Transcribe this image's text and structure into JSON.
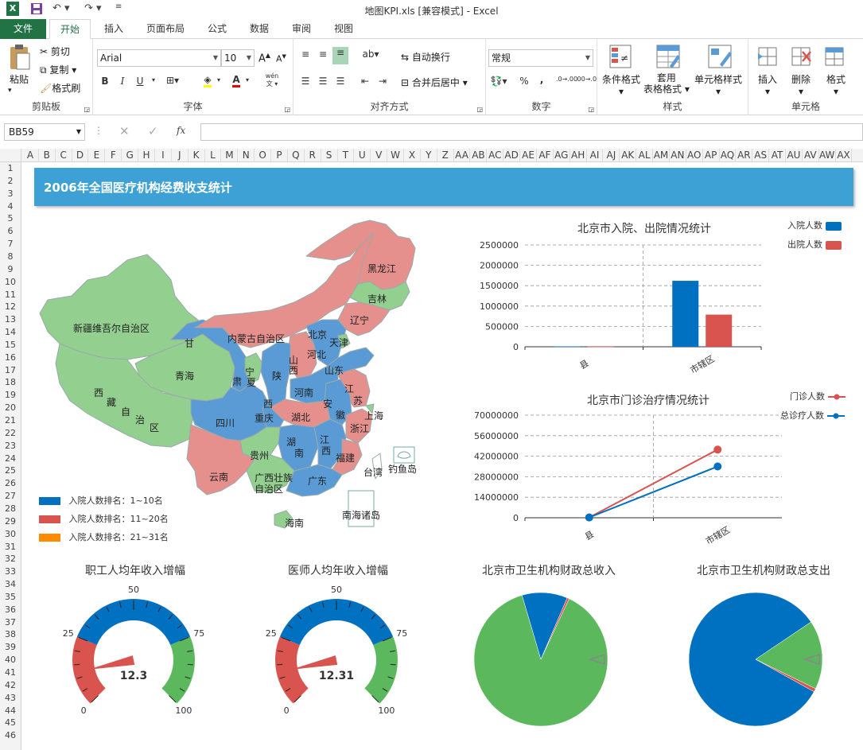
{
  "window": {
    "title": "地图KPI.xls  [兼容模式] - Excel"
  },
  "tabs": {
    "file": "文件",
    "items": [
      "开始",
      "插入",
      "页面布局",
      "公式",
      "数据",
      "审阅",
      "视图"
    ]
  },
  "ribbon": {
    "clipboard": {
      "paste": "粘贴",
      "cut": "剪切",
      "copy": "复制",
      "format_painter": "格式刷",
      "label": "剪贴板"
    },
    "font": {
      "name": "Arial",
      "size": "10",
      "label": "字体",
      "bold": "B",
      "italic": "I",
      "underline": "U",
      "phonetic": "wén"
    },
    "alignment": {
      "wrap": "自动换行",
      "merge": "合并后居中",
      "label": "对齐方式"
    },
    "number": {
      "format": "常规",
      "label": "数字",
      "percent": "%",
      "comma": ","
    },
    "styles": {
      "conditional": "条件格式",
      "table": "套用\n表格格式",
      "cell_styles": "单元格样式",
      "label": "样式"
    },
    "cells": {
      "insert": "插入",
      "delete": "删除",
      "format": "格式",
      "label": "单元格"
    }
  },
  "formula_bar": {
    "name_box": "BB59",
    "fx": "fx",
    "value": ""
  },
  "columns": [
    "A",
    "B",
    "C",
    "D",
    "E",
    "F",
    "G",
    "H",
    "I",
    "J",
    "K",
    "L",
    "M",
    "N",
    "O",
    "P",
    "Q",
    "R",
    "S",
    "T",
    "U",
    "V",
    "W",
    "X",
    "Y",
    "Z",
    "AA",
    "AB",
    "AC",
    "AD",
    "AE",
    "AF",
    "AG",
    "AH",
    "AI",
    "AJ",
    "AK",
    "AL",
    "AM",
    "AN",
    "AO",
    "AP",
    "AQ",
    "AR",
    "AS",
    "AT",
    "AU",
    "AV",
    "AW",
    "AX"
  ],
  "rows": [
    "1",
    "2",
    "3",
    "4",
    "5",
    "6",
    "7",
    "8",
    "9",
    "10",
    "11",
    "12",
    "13",
    "14",
    "15",
    "16",
    "17",
    "18",
    "19",
    "20",
    "21",
    "22",
    "23",
    "24",
    "25",
    "26",
    "27",
    "28",
    "29",
    "30",
    "31",
    "32",
    "33",
    "34",
    "35",
    "36",
    "37",
    "38",
    "39",
    "40",
    "41",
    "42",
    "43",
    "44",
    "45",
    "46"
  ],
  "dashboard": {
    "title": "2006年全国医疗机构经费收支统计",
    "colors": {
      "blue": "#0070c0",
      "red": "#d9534f",
      "green": "#5cb85c",
      "orange": "#ff8c00",
      "map_blue": "#5b9bd5",
      "map_red": "#e6908e",
      "map_green": "#93cf8f"
    },
    "map": {
      "legend": [
        {
          "label": "入院人数排名：1~10名",
          "color": "#0070c0"
        },
        {
          "label": "入院人数排名：11~20名",
          "color": "#d9534f"
        },
        {
          "label": "入院人数排名：21~31名",
          "color": "#ff8c00"
        }
      ],
      "regions": {
        "xinjiang": "新疆维吾尔自治区",
        "tibet": [
          "西",
          "藏",
          "自",
          "治",
          "区"
        ],
        "qinghai": "青海",
        "gansu_a": "甘",
        "gansu_b": "肃",
        "ningxia_a": "宁",
        "ningxia_b": "夏",
        "neimenggu": "内蒙古自治区",
        "heilongjiang": "黑龙江",
        "jilin": "吉林",
        "liaoning": "辽宁",
        "beijing": "北京",
        "tianjin": "天津",
        "hebei": "河北",
        "shanxi_a": "山",
        "shanxi_b": "西",
        "shaanxi_a": "陕",
        "shaanxi_b": "西",
        "shandong": "山东",
        "henan": "河南",
        "jiangsu_a": "江",
        "jiangsu_b": "苏",
        "anhui_a": "安",
        "anhui_b": "徽",
        "shanghai": "上海",
        "sichuan": "四川",
        "chongqing": "重庆",
        "hubei": "湖北",
        "zhejiang": "浙江",
        "hunan_a": "湖",
        "hunan_b": "南",
        "jiangxi_a": "江",
        "jiangxi_b": "西",
        "fujian": "福建",
        "guizhou": "贵州",
        "yunnan": "云南",
        "guangxi": [
          "广西壮族",
          "自治区"
        ],
        "guangdong": "广东",
        "taiwan": "台湾",
        "diaoyu": "钓鱼岛",
        "hainan": "海南",
        "nanhai": "南海诸岛"
      }
    },
    "legend_admit": {
      "admit": "入院人数",
      "discharge": "出院人数"
    },
    "legend_outpatient": {
      "outpatient": "门诊人数",
      "total": "总诊疗人数"
    },
    "gauge_labels": {
      "ticks": [
        "0",
        "25",
        "50",
        "75",
        "100"
      ]
    }
  },
  "chart_data": [
    {
      "type": "bar",
      "title": "北京市入院、出院情况统计",
      "categories": [
        "县",
        "市辖区"
      ],
      "series": [
        {
          "name": "入院人数",
          "values": [
            10000,
            1620000
          ],
          "color": "#0070c0"
        },
        {
          "name": "出院人数",
          "values": [
            5000,
            790000
          ],
          "color": "#d9534f"
        }
      ],
      "ylim": [
        0,
        2500000
      ],
      "yticks": [
        0,
        500000,
        1000000,
        1500000,
        2000000,
        2500000
      ],
      "grid": true,
      "legend": "top-right"
    },
    {
      "type": "line",
      "title": "北京市门诊治疗情况统计",
      "categories": [
        "县",
        "市辖区"
      ],
      "series": [
        {
          "name": "门诊人数",
          "values": [
            200000,
            46500000
          ],
          "color": "#d9534f"
        },
        {
          "name": "总诊疗人数",
          "values": [
            200000,
            35000000
          ],
          "color": "#0070c0"
        }
      ],
      "ylim": [
        0,
        70000000
      ],
      "yticks": [
        0,
        14000000,
        28000000,
        42000000,
        56000000,
        70000000
      ],
      "grid": true,
      "legend": "top-right"
    },
    {
      "type": "gauge",
      "title": "职工人均年收入增幅",
      "value": 12.3,
      "display": "12.3",
      "min": 0,
      "max": 100,
      "bands": [
        {
          "from": 0,
          "to": 25,
          "color": "#d9534f"
        },
        {
          "from": 25,
          "to": 75,
          "color": "#0070c0"
        },
        {
          "from": 75,
          "to": 100,
          "color": "#5cb85c"
        }
      ]
    },
    {
      "type": "gauge",
      "title": "医师人均年收入增幅",
      "value": 12.31,
      "display": "12.31",
      "min": 0,
      "max": 100,
      "bands": [
        {
          "from": 0,
          "to": 25,
          "color": "#d9534f"
        },
        {
          "from": 25,
          "to": 75,
          "color": "#0070c0"
        },
        {
          "from": 75,
          "to": 100,
          "color": "#5cb85c"
        }
      ]
    },
    {
      "type": "pie",
      "title": "北京市卫生机构财政总收入",
      "slices": [
        {
          "value": 88.5,
          "color": "#5cb85c"
        },
        {
          "value": 11.0,
          "color": "#0070c0"
        },
        {
          "value": 0.5,
          "color": "#d9534f"
        }
      ]
    },
    {
      "type": "pie",
      "title": "北京市卫生机构财政总支出",
      "slices": [
        {
          "value": 82.5,
          "color": "#0070c0"
        },
        {
          "value": 16.7,
          "color": "#5cb85c"
        },
        {
          "value": 0.8,
          "color": "#d9534f"
        }
      ]
    }
  ]
}
